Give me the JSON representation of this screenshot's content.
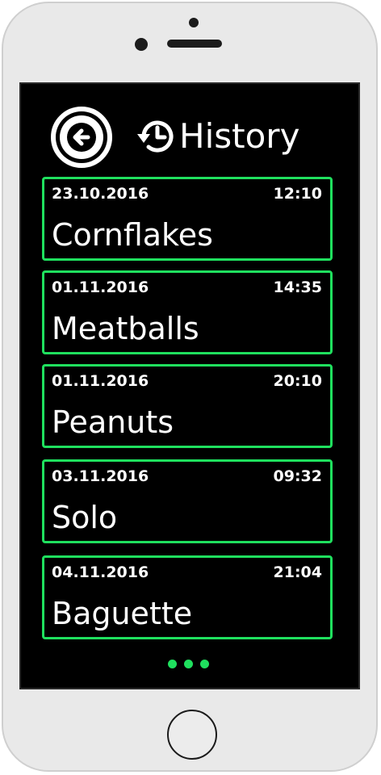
{
  "header": {
    "title": "History",
    "back_icon": "back-arrow-icon",
    "history_icon": "history-clock-icon"
  },
  "history": [
    {
      "date": "23.10.2016",
      "time": "12:10",
      "name": "Cornflakes"
    },
    {
      "date": "01.11.2016",
      "time": "14:35",
      "name": "Meatballs"
    },
    {
      "date": "01.11.2016",
      "time": "20:10",
      "name": "Peanuts"
    },
    {
      "date": "03.11.2016",
      "time": "09:32",
      "name": "Solo"
    },
    {
      "date": "04.11.2016",
      "time": "21:04",
      "name": "Baguette"
    }
  ],
  "pager": {
    "count": 3
  },
  "colors": {
    "accent": "#1fe05e",
    "background": "#000000",
    "text": "#ffffff"
  }
}
